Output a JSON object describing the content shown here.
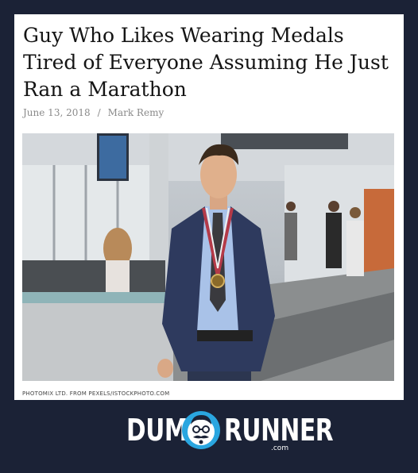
{
  "article": {
    "title": "Guy Who Likes Wearing Medals Tired of Everyone Assuming He Just Ran a Marathon",
    "date": "June 13, 2018",
    "separator": "/",
    "author": "Mark Remy",
    "image_alt": "Man in a suit wearing a medal standing in an airport terminal",
    "image_credit": "PHOTOMIX LTD. FROM PEXELS/ISTOCKPHOTO.COM"
  },
  "brand": {
    "left_word": "DUMB",
    "right_word": "RUNNER",
    "suffix": ".com",
    "logo_icon": "mustached-face-icon",
    "accent_color": "#2aa6e0"
  },
  "colors": {
    "background": "#1b2236",
    "card": "#ffffff",
    "meta_text": "#8a8a8a"
  }
}
